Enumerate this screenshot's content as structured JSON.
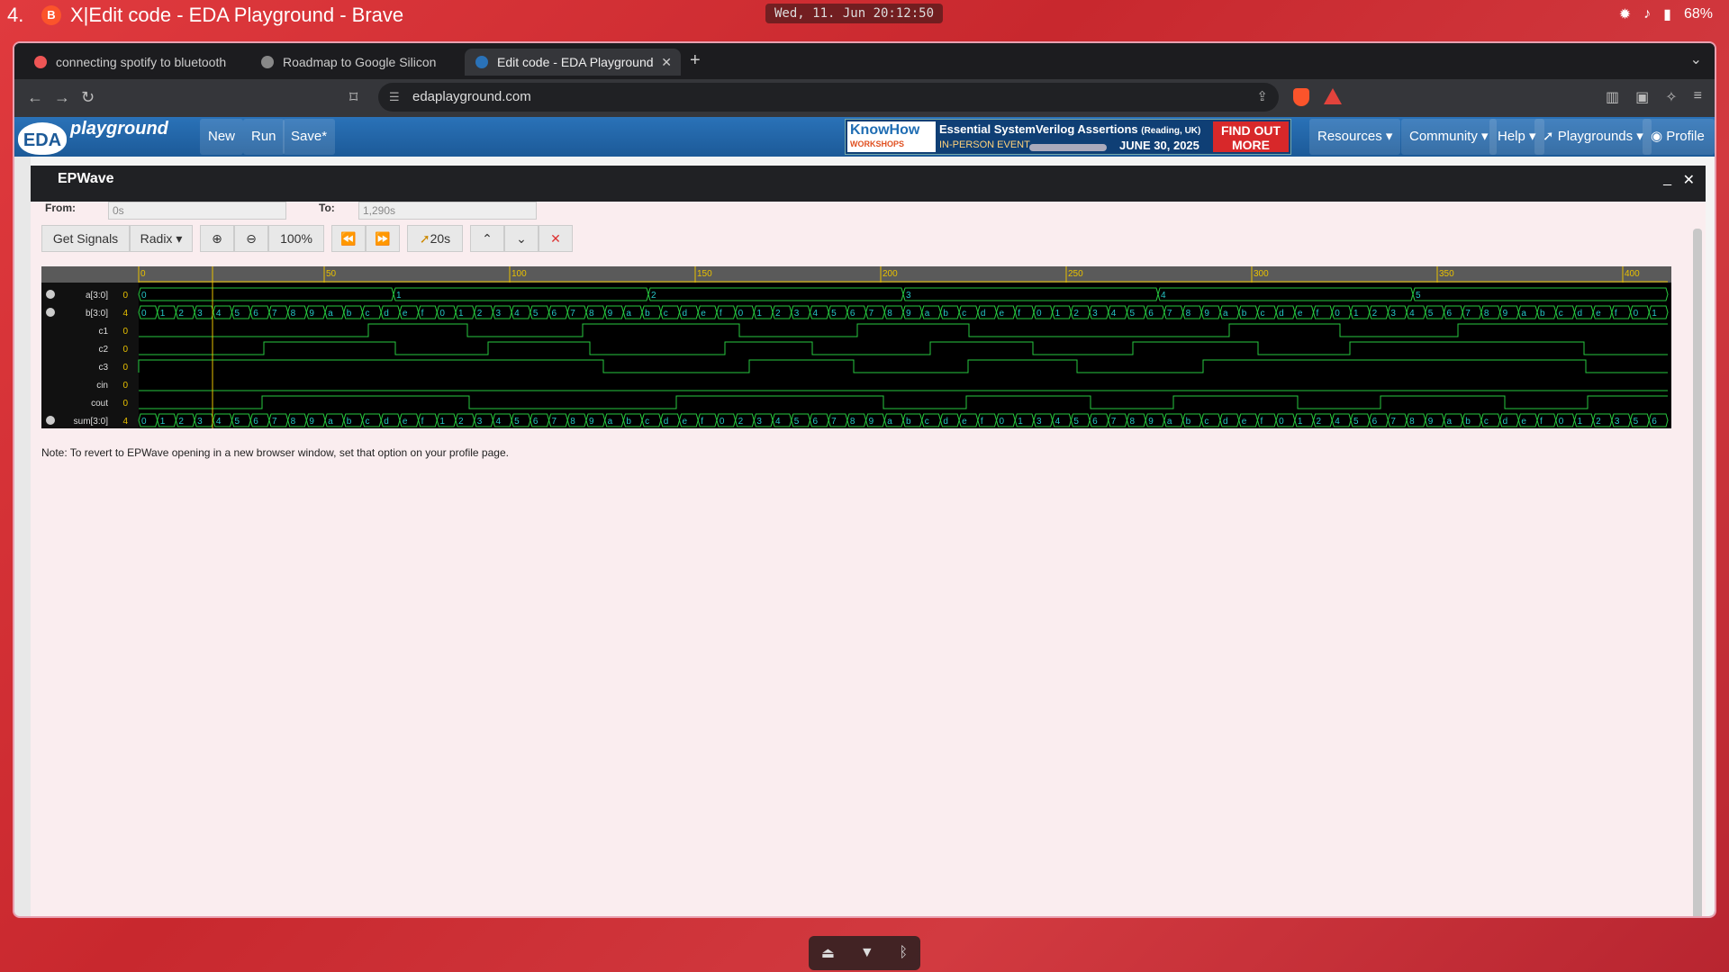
{
  "topbar": {
    "workspace": "4.",
    "window_title": "X|Edit code - EDA Playground - Brave",
    "clock": "Wed, 11. Jun  20:12:50",
    "battery": "68%"
  },
  "tabs": [
    {
      "label": "connecting spotify to bluetooth"
    },
    {
      "label": "Roadmap to Google Silicon"
    },
    {
      "label": "Edit code - EDA Playground"
    }
  ],
  "address": {
    "url": "edaplayground.com",
    "shield_badge": "5",
    "rewards_badge": "1"
  },
  "nav": {
    "logo_eda": "EDA",
    "logo_text": "playground",
    "new": "New",
    "run": "Run",
    "save": "Save*",
    "resources": "Resources",
    "community": "Community",
    "help": "Help",
    "playgrounds": "Playgrounds",
    "profile": "Profile"
  },
  "ad": {
    "brand": "KnowHow",
    "brand_sub": "WORKSHOPS",
    "title": "Essential SystemVerilog Assertions",
    "title_loc": "(Reading, UK)",
    "subtitle": "IN-PERSON EVENT",
    "date": "JUNE 30, 2025",
    "cta": "FIND OUT MORE"
  },
  "modal": {
    "title": "EPWave",
    "from_label": "From:",
    "from_value": "0s",
    "to_label": "To:",
    "to_value": "1,290s",
    "toolbar": {
      "get_signals": "Get Signals",
      "radix": "Radix",
      "zoom": "100%",
      "marker": "20s"
    },
    "note": "Note: To revert to EPWave opening in a new browser window, set that option on your profile page."
  },
  "timeline": {
    "ticks": [
      "0",
      "50",
      "100",
      "150",
      "200",
      "250",
      "300",
      "350",
      "400"
    ]
  },
  "signals": [
    {
      "name": "a[3:0]",
      "value": "0",
      "bus": true,
      "expandable": true,
      "segments": [
        "0",
        "1",
        "2",
        "3",
        "4",
        "5"
      ]
    },
    {
      "name": "b[3:0]",
      "value": "4",
      "bus": true,
      "expandable": true,
      "segments": [
        "0",
        "1",
        "2",
        "3",
        "4",
        "5",
        "6",
        "7",
        "8",
        "9",
        "a",
        "b",
        "c",
        "d",
        "e",
        "f",
        "0",
        "1",
        "2",
        "3",
        "4",
        "5",
        "6",
        "7",
        "8",
        "9",
        "a",
        "b",
        "c",
        "d",
        "e",
        "f",
        "0",
        "1",
        "2",
        "3",
        "4",
        "5",
        "6",
        "7",
        "8",
        "9",
        "a",
        "b",
        "c",
        "d",
        "e",
        "f",
        "0",
        "1",
        "2",
        "3",
        "4",
        "5",
        "6",
        "7",
        "8",
        "9",
        "a",
        "b",
        "c",
        "d",
        "e",
        "f",
        "0",
        "1",
        "2",
        "3",
        "4",
        "5",
        "6",
        "7",
        "8",
        "9",
        "a",
        "b",
        "c",
        "d",
        "e",
        "f",
        "0",
        "1"
      ]
    },
    {
      "name": "c1",
      "value": "0",
      "bus": false,
      "expandable": false
    },
    {
      "name": "c2",
      "value": "0",
      "bus": false,
      "expandable": false
    },
    {
      "name": "c3",
      "value": "0",
      "bus": false,
      "expandable": false
    },
    {
      "name": "cin",
      "value": "0",
      "bus": false,
      "expandable": false
    },
    {
      "name": "cout",
      "value": "0",
      "bus": false,
      "expandable": false
    },
    {
      "name": "sum[3:0]",
      "value": "4",
      "bus": true,
      "expandable": true,
      "segments": [
        "0",
        "1",
        "2",
        "3",
        "4",
        "5",
        "6",
        "7",
        "8",
        "9",
        "a",
        "b",
        "c",
        "d",
        "e",
        "f",
        "1",
        "2",
        "3",
        "4",
        "5",
        "6",
        "7",
        "8",
        "9",
        "a",
        "b",
        "c",
        "d",
        "e",
        "f",
        "0",
        "2",
        "3",
        "4",
        "5",
        "6",
        "7",
        "8",
        "9",
        "a",
        "b",
        "c",
        "d",
        "e",
        "f",
        "0",
        "1",
        "3",
        "4",
        "5",
        "6",
        "7",
        "8",
        "9",
        "a",
        "b",
        "c",
        "d",
        "e",
        "f",
        "0",
        "1",
        "2",
        "4",
        "5",
        "6",
        "7",
        "8",
        "9",
        "a",
        "b",
        "c",
        "d",
        "e",
        "f",
        "0",
        "1",
        "2",
        "3",
        "5",
        "6"
      ]
    }
  ],
  "colors": {
    "wave_green": "#27c93f",
    "wave_cyan": "#25c6c6",
    "cursor": "#e8c000",
    "navbar": "#1c5a98"
  }
}
